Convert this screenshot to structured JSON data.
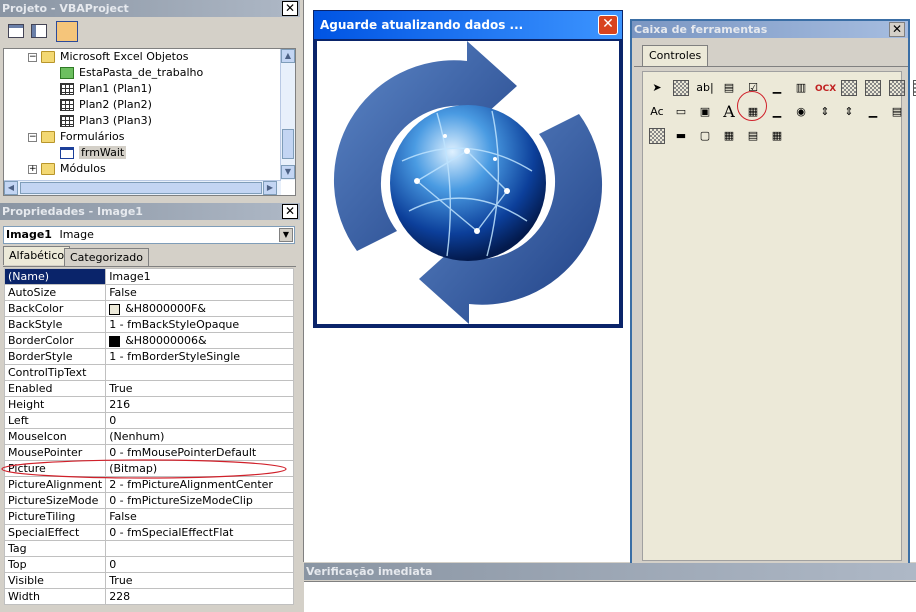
{
  "project_panel": {
    "title": "Projeto - VBAProject",
    "tree": [
      {
        "label": "Microsoft Excel Objetos",
        "icon": "folder-open-icon",
        "expander": "−"
      },
      {
        "label": "EstaPasta_de_trabalho",
        "icon": "workbook-icon"
      },
      {
        "label": "Plan1 (Plan1)",
        "icon": "worksheet-icon"
      },
      {
        "label": "Plan2 (Plan2)",
        "icon": "worksheet-icon"
      },
      {
        "label": "Plan3 (Plan3)",
        "icon": "worksheet-icon"
      },
      {
        "label": "Formulários",
        "icon": "folder-open-icon",
        "expander": "−"
      },
      {
        "label": "frmWait",
        "icon": "userform-icon"
      },
      {
        "label": "Módulos",
        "icon": "folder-icon",
        "expander": "+"
      }
    ]
  },
  "properties_panel": {
    "title": "Propriedades - Image1",
    "object_name": "Image1",
    "object_type": "Image",
    "tabs": [
      "Alfabético",
      "Categorizado"
    ],
    "rows": [
      {
        "name": "(Name)",
        "value": "Image1"
      },
      {
        "name": "AutoSize",
        "value": "False"
      },
      {
        "name": "BackColor",
        "value": "&H8000000F&",
        "swatch": "#ece9d8"
      },
      {
        "name": "BackStyle",
        "value": "1 - fmBackStyleOpaque"
      },
      {
        "name": "BorderColor",
        "value": "&H80000006&",
        "swatch": "#000000"
      },
      {
        "name": "BorderStyle",
        "value": "1 - fmBorderStyleSingle"
      },
      {
        "name": "ControlTipText",
        "value": ""
      },
      {
        "name": "Enabled",
        "value": "True"
      },
      {
        "name": "Height",
        "value": "216"
      },
      {
        "name": "Left",
        "value": "0"
      },
      {
        "name": "MouseIcon",
        "value": "(Nenhum)"
      },
      {
        "name": "MousePointer",
        "value": "0 - fmMousePointerDefault"
      },
      {
        "name": "Picture",
        "value": "(Bitmap)"
      },
      {
        "name": "PictureAlignment",
        "value": "2 - fmPictureAlignmentCenter"
      },
      {
        "name": "PictureSizeMode",
        "value": "0 - fmPictureSizeModeClip"
      },
      {
        "name": "PictureTiling",
        "value": "False"
      },
      {
        "name": "SpecialEffect",
        "value": "0 - fmSpecialEffectFlat"
      },
      {
        "name": "Tag",
        "value": ""
      },
      {
        "name": "Top",
        "value": "0"
      },
      {
        "name": "Visible",
        "value": "True"
      },
      {
        "name": "Width",
        "value": "228"
      }
    ]
  },
  "form": {
    "title": "Aguarde atualizando dados ..."
  },
  "toolbox": {
    "title": "Caixa de ferramentas",
    "tab": "Controles",
    "tools": [
      {
        "glyph": "➤",
        "name": "pointer-tool-icon"
      },
      {
        "glyph": "",
        "name": "select-objects-tool-icon",
        "pattern": true
      },
      {
        "glyph": "ab|",
        "name": "textbox-tool-icon"
      },
      {
        "glyph": "▤",
        "name": "listbox-tool-icon"
      },
      {
        "glyph": "☑",
        "name": "checkbox-tool-icon"
      },
      {
        "glyph": "▁",
        "name": "label-line-tool-icon"
      },
      {
        "glyph": "▥",
        "name": "chart-tool-icon"
      },
      {
        "glyph": "OCX",
        "name": "ocx-tool-icon"
      },
      {
        "glyph": "",
        "name": "custom-control-1-icon",
        "pattern": true
      },
      {
        "glyph": "",
        "name": "custom-control-2-icon",
        "pattern": true
      },
      {
        "glyph": "",
        "name": "custom-control-3-icon",
        "pattern": true
      },
      {
        "glyph": "",
        "name": "custom-control-4-icon",
        "pattern": true
      },
      {
        "glyph": "Ac",
        "name": "label-tool-icon"
      },
      {
        "glyph": "▭",
        "name": "frame-tool-icon"
      },
      {
        "glyph": "▣",
        "name": "image-tool-icon"
      },
      {
        "glyph": "A",
        "name": "font-tool-icon"
      },
      {
        "glyph": "▦",
        "name": "listview-tool-icon"
      },
      {
        "glyph": "▁",
        "name": "line-tool-icon"
      },
      {
        "glyph": "◉",
        "name": "optionbutton-tool-icon"
      },
      {
        "glyph": "⇕",
        "name": "spinbutton-tool-icon"
      },
      {
        "glyph": "⇕",
        "name": "scrollbar-tool-icon"
      },
      {
        "glyph": "▁",
        "name": "separator-tool-icon"
      },
      {
        "glyph": "▤",
        "name": "multipage-tool-icon"
      },
      {
        "glyph": "▭",
        "name": "tabstrip-tool-icon"
      },
      {
        "glyph": "",
        "name": "custom-control-5-icon",
        "pattern": true
      },
      {
        "glyph": "▬",
        "name": "progress-tool-icon"
      },
      {
        "glyph": "▢",
        "name": "commandbutton-tool-icon"
      },
      {
        "glyph": "▦",
        "name": "grid-tool-icon"
      },
      {
        "glyph": "▤",
        "name": "treeview-tool-icon"
      },
      {
        "glyph": "▦",
        "name": "calendar-tool-icon"
      }
    ]
  },
  "immediate_panel": {
    "title": "Verificação imediata"
  }
}
